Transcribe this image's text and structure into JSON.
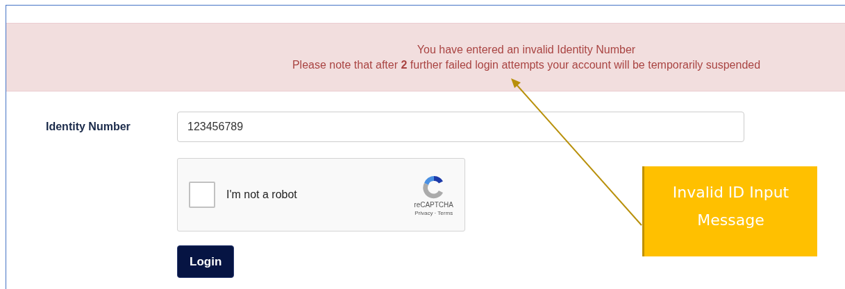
{
  "alert": {
    "lines": [
      "You have entered an invalid Identity Number",
      "Please note that after **2** further failed login attempts your account will be temporarily suspended"
    ]
  },
  "form": {
    "label": "Identity Number",
    "value": "123456789"
  },
  "captcha": {
    "checked": false,
    "label": "I'm not a robot",
    "brand": "reCAPTCHA",
    "links": "Privacy · Terms"
  },
  "login_button": "Login",
  "callout": {
    "text": "Invalid ID Input Message"
  }
}
